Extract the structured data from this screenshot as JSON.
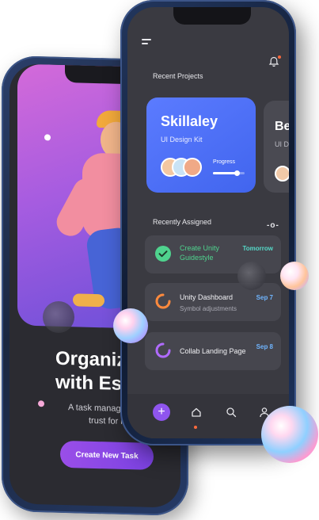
{
  "onboarding": {
    "title_line1": "Organize",
    "title_line2": "with Est",
    "subtitle_line1": "A task manager",
    "subtitle_line2": "trust for li",
    "cta_label": "Create New Task"
  },
  "dashboard": {
    "recent_projects_title": "Recent Projects",
    "projects": [
      {
        "name": "Skillaley",
        "subtitle": "UI Design Kit",
        "progress_label": "Progress",
        "progress": 0.75
      },
      {
        "name": "Be",
        "subtitle": "UI D"
      }
    ],
    "recently_assigned_title": "Recently Assigned",
    "more_label": "-o-",
    "tasks": [
      {
        "title_line1": "Create Unity",
        "title_line2": "Guidestyle",
        "subtitle": "",
        "date": "Tomorrow",
        "status": "done"
      },
      {
        "title_line1": "Unity Dashboard",
        "title_line2": "",
        "subtitle": "Symbol adjustments",
        "date": "Sep 7",
        "status": "in-progress"
      },
      {
        "title_line1": "Collab Landing Page",
        "title_line2": "",
        "subtitle": "",
        "date": "Sep 8",
        "status": "in-progress"
      }
    ],
    "tabbar": {
      "add_label": "+",
      "tabs": [
        "home-icon",
        "search-icon",
        "profile-icon"
      ]
    }
  },
  "colors": {
    "accent_blue": "#4f6ff5",
    "accent_purple": "#8f55ee",
    "done_green": "#4fd38e",
    "date_teal": "#55d9c8",
    "date_blue": "#6fb5ff",
    "notification_orange": "#ff6a3d"
  }
}
